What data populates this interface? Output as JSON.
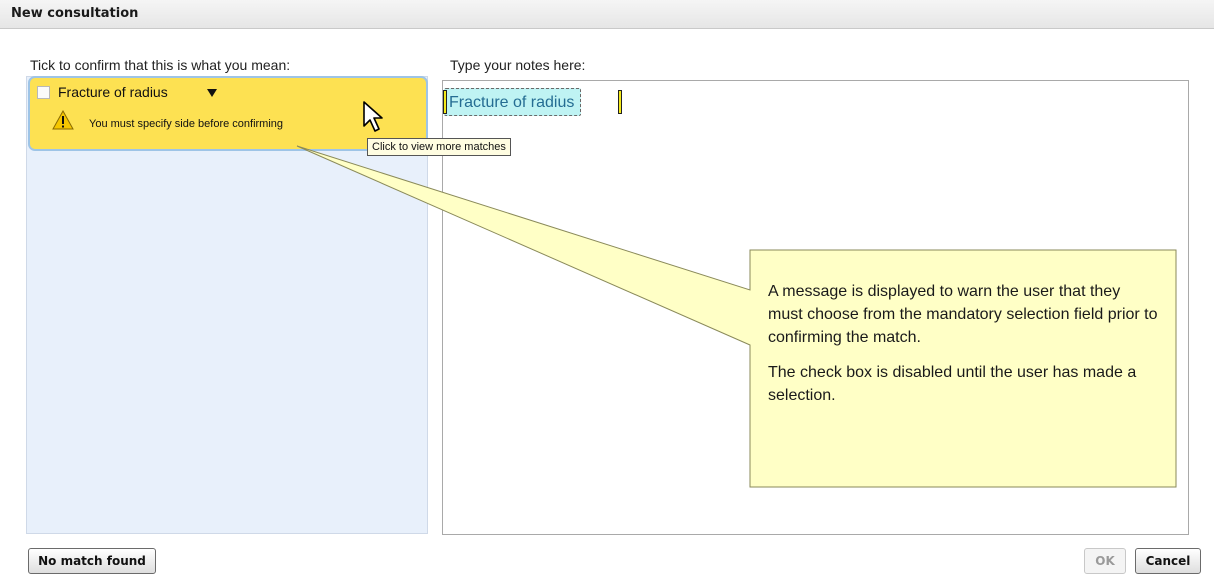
{
  "window": {
    "title": "New consultation"
  },
  "left_panel": {
    "label": "Tick to confirm that this is what you mean:"
  },
  "match": {
    "term": "Fracture of radius",
    "warning": "You must specify side before confirming",
    "tooltip": "Click to view more matches"
  },
  "notes": {
    "label": "Type your notes here:",
    "term": "Fracture of radius"
  },
  "callout": {
    "paragraph1": "A message is displayed to warn the user that they must choose from the mandatory selection field prior to confirming the match.",
    "paragraph2": "The check box is disabled until the user has made a selection."
  },
  "buttons": {
    "no_match": "No match found",
    "ok": "OK",
    "cancel": "Cancel"
  },
  "colors": {
    "match_highlight": "#fde152",
    "panel_bg": "#e8f0fb",
    "callout_bg": "#ffffc6",
    "notes_term_bg": "#bff3f3"
  },
  "icons": {
    "warning": "warning-triangle-icon",
    "cursor": "mouse-pointer-icon",
    "dropdown": "dropdown-arrow-icon"
  }
}
